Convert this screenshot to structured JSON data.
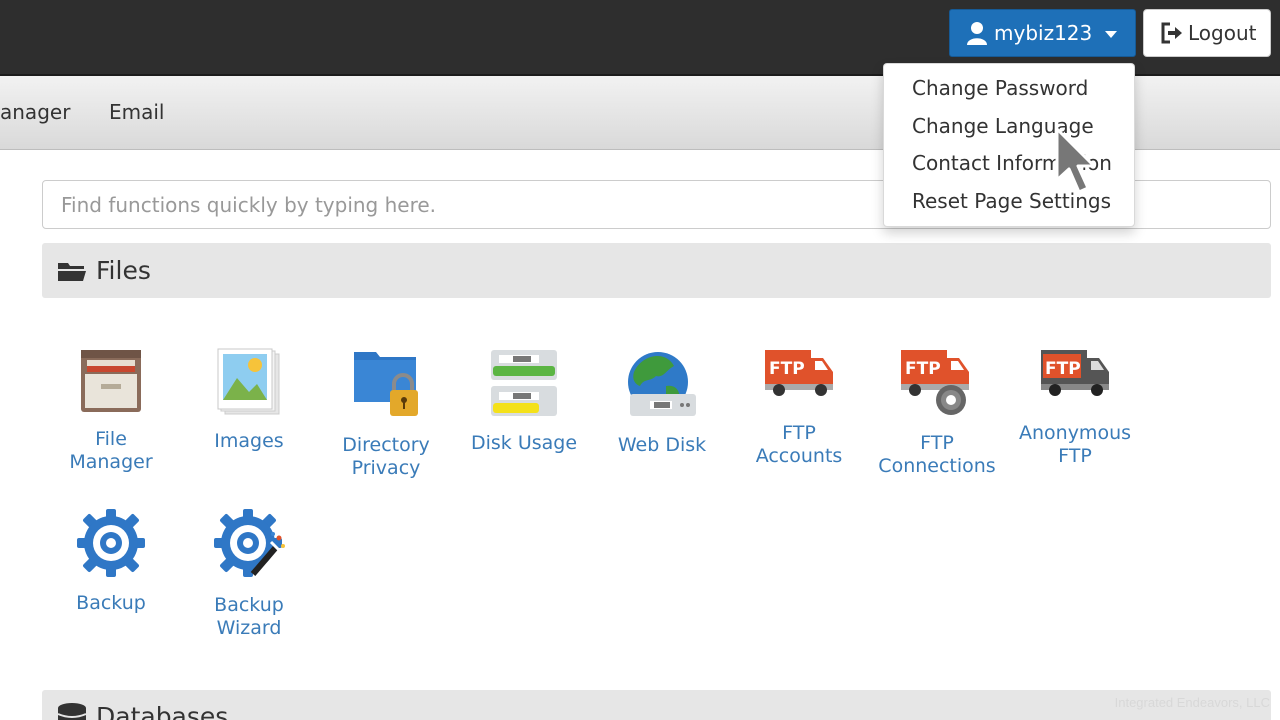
{
  "header": {
    "username": "mybiz123",
    "logout_label": "Logout"
  },
  "nav": {
    "items": [
      {
        "label": "anager"
      },
      {
        "label": "Email"
      }
    ]
  },
  "search": {
    "placeholder": "Find functions quickly by typing here."
  },
  "user_menu": {
    "items": [
      {
        "label": "Change Password"
      },
      {
        "label": "Change Language"
      },
      {
        "label": "Contact Information"
      },
      {
        "label": "Reset Page Settings"
      }
    ]
  },
  "sections": [
    {
      "title": "Files",
      "icon": "folder-icon",
      "tiles": [
        {
          "label": "File\nManager",
          "icon": "file-cabinet-icon"
        },
        {
          "label": "Images",
          "icon": "images-icon"
        },
        {
          "label": "Directory\nPrivacy",
          "icon": "folder-lock-icon"
        },
        {
          "label": "Disk Usage",
          "icon": "disk-drive-icon"
        },
        {
          "label": "Web Disk",
          "icon": "globe-drive-icon"
        },
        {
          "label": "FTP\nAccounts",
          "icon": "ftp-truck-icon"
        },
        {
          "label": "FTP\nConnections",
          "icon": "ftp-truck-gear-icon"
        },
        {
          "label": "Anonymous\nFTP",
          "icon": "ftp-truck-dark-icon"
        },
        {
          "label": "Backup",
          "icon": "backup-icon"
        },
        {
          "label": "Backup\nWizard",
          "icon": "backup-wizard-icon"
        }
      ]
    },
    {
      "title": "Databases",
      "icon": "database-icon"
    }
  ],
  "footer": {
    "watermark": "Integrated Endeavors, LLC"
  }
}
